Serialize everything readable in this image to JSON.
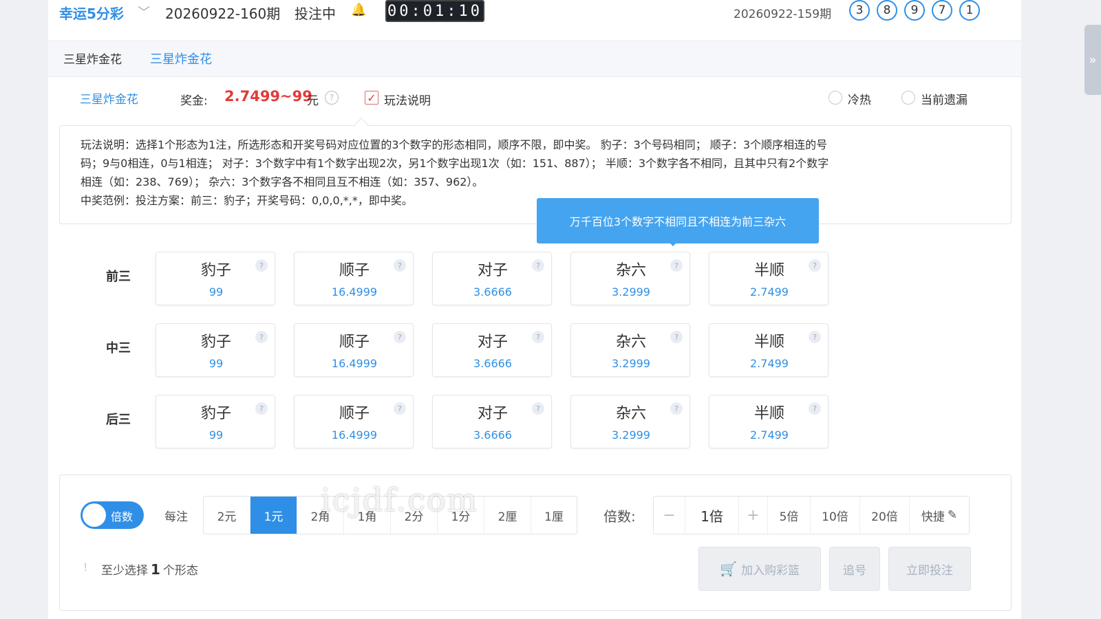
{
  "header": {
    "lottery_name": "幸运5分彩",
    "period": "20260922-160期",
    "status": "投注中",
    "bell_icon": "bell-icon",
    "timer": "00:01:10",
    "last_period": "20260922-159期",
    "last_draw": [
      "3",
      "8",
      "9",
      "7",
      "1"
    ]
  },
  "tabs": [
    "三星炸金花",
    "三星炸金花"
  ],
  "playbar": {
    "play_name": "三星炸金花",
    "prize_label": "奖金:",
    "prize_value": "2.7499~99",
    "prize_unit": "元",
    "checkbox_label": "玩法说明",
    "radio_cold_hot": "冷热",
    "radio_missing": "当前遗漏"
  },
  "explanation": {
    "lines": [
      "玩法说明：选择1个形态为1注，所选形态和开奖号码对应位置的3个数字的形态相同，顺序不限，即中奖。 豹子：3个号码相同； 顺子：3个顺序相连的号",
      "码；9与0相连，0与1相连； 对子：3个数字中有1个数字出现2次，另1个数字出现1次（如：151、887）； 半顺：3个数字各不相同，且其中只有2个数字",
      "相连（如：238、769）； 杂六：3个数字各不相同且互不相连（如：357、962）。",
      "中奖范例：投注方案：前三：豹子；开奖号码：0,0,0,*,*，即中奖。"
    ]
  },
  "tooltip": "万千百位3个数字不相同且不相连为前三杂六",
  "grid": {
    "rows": [
      {
        "label": "前三",
        "cells": [
          {
            "name": "豹子",
            "odds": "99"
          },
          {
            "name": "顺子",
            "odds": "16.4999"
          },
          {
            "name": "对子",
            "odds": "3.6666"
          },
          {
            "name": "杂六",
            "odds": "3.2999"
          },
          {
            "name": "半顺",
            "odds": "2.7499"
          }
        ]
      },
      {
        "label": "中三",
        "cells": [
          {
            "name": "豹子",
            "odds": "99"
          },
          {
            "name": "顺子",
            "odds": "16.4999"
          },
          {
            "name": "对子",
            "odds": "3.6666"
          },
          {
            "name": "杂六",
            "odds": "3.2999"
          },
          {
            "name": "半顺",
            "odds": "2.7499"
          }
        ]
      },
      {
        "label": "后三",
        "cells": [
          {
            "name": "豹子",
            "odds": "99"
          },
          {
            "name": "顺子",
            "odds": "16.4999"
          },
          {
            "name": "对子",
            "odds": "3.6666"
          },
          {
            "name": "杂六",
            "odds": "3.2999"
          },
          {
            "name": "半顺",
            "odds": "2.7499"
          }
        ]
      }
    ]
  },
  "bottom": {
    "toggle_label": "倍数",
    "unit_label": "每注",
    "units": [
      "2元",
      "1元",
      "2角",
      "1角",
      "2分",
      "1分",
      "2厘",
      "1厘"
    ],
    "active_unit": "1元",
    "multiplier_label": "倍数:",
    "multiplier_value": "1倍",
    "quick_multipliers": [
      "5倍",
      "10倍",
      "20倍"
    ],
    "quick_label": "快捷",
    "hint_prefix": "至少选择",
    "hint_count": "1",
    "hint_suffix": "个形态",
    "add_cart": "加入购彩篮",
    "chase": "追号",
    "bet_now": "立即投注"
  },
  "watermark": "icjdf.com",
  "colors": {
    "accent": "#2f8fe6",
    "prize": "#e23b3b",
    "tooltip": "#45a4ef"
  }
}
